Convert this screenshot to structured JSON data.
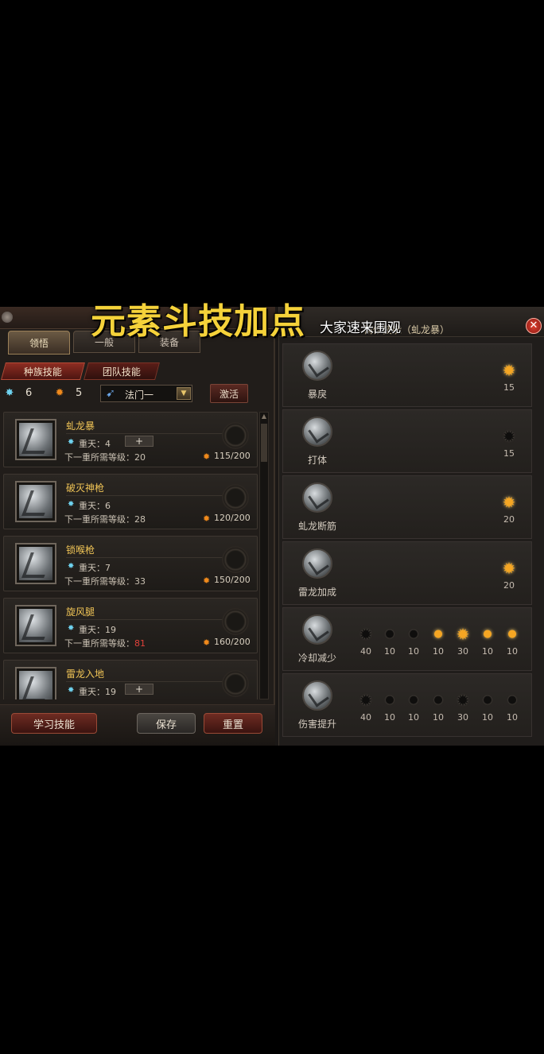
{
  "overlay": {
    "main_caption": "元素斗技加点",
    "sub_caption": "大家速来围观"
  },
  "left_panel": {
    "tabs": [
      {
        "label": "领悟",
        "active": true
      },
      {
        "label": "一般",
        "active": false
      },
      {
        "label": "装备",
        "active": false
      }
    ],
    "subtabs": [
      {
        "label": "种族技能",
        "active": true
      },
      {
        "label": "团队技能",
        "active": false
      }
    ],
    "points": {
      "blue": "6",
      "orange": "5"
    },
    "class_select": {
      "value": "法门一"
    },
    "activate_label": "激活",
    "skills": [
      {
        "name": "虬龙暴",
        "level": "重天：4",
        "req_prefix": "下一重所需等级：",
        "req_value": "20",
        "req_red": false,
        "cost": "115/200",
        "has_plus": true
      },
      {
        "name": "破灭神枪",
        "level": "重天：6",
        "req_prefix": "下一重所需等级：",
        "req_value": "28",
        "req_red": false,
        "cost": "120/200",
        "has_plus": false
      },
      {
        "name": "锁喉枪",
        "level": "重天：7",
        "req_prefix": "下一重所需等级：",
        "req_value": "33",
        "req_red": false,
        "cost": "150/200",
        "has_plus": false
      },
      {
        "name": "旋风腿",
        "level": "重天：19",
        "req_prefix": "下一重所需等级：",
        "req_value": "81",
        "req_red": true,
        "cost": "160/200",
        "has_plus": false
      },
      {
        "name": "雷龙入地",
        "level": "重天：19",
        "req_prefix": "",
        "req_value": "",
        "req_red": false,
        "cost": "",
        "has_plus": true
      }
    ],
    "buttons": {
      "learn": "学习技能",
      "save": "保存",
      "reset": "重置"
    }
  },
  "right_panel": {
    "title": "精修技能（虬龙暴）",
    "rows": [
      {
        "label": "暴戾",
        "nodes": [
          {
            "value": "15",
            "active": true,
            "shape": "star"
          }
        ]
      },
      {
        "label": "打体",
        "nodes": [
          {
            "value": "15",
            "active": false,
            "shape": "star"
          }
        ]
      },
      {
        "label": "虬龙断筋",
        "nodes": [
          {
            "value": "20",
            "active": true,
            "shape": "star"
          }
        ]
      },
      {
        "label": "雷龙加成",
        "nodes": [
          {
            "value": "20",
            "active": true,
            "shape": "star"
          }
        ]
      },
      {
        "label": "冷却减少",
        "nodes": [
          {
            "value": "40",
            "active": false,
            "shape": "star"
          },
          {
            "value": "10",
            "active": false,
            "shape": "dot"
          },
          {
            "value": "10",
            "active": false,
            "shape": "dot"
          },
          {
            "value": "10",
            "active": true,
            "shape": "dot"
          },
          {
            "value": "30",
            "active": true,
            "shape": "star"
          },
          {
            "value": "10",
            "active": true,
            "shape": "dot"
          },
          {
            "value": "10",
            "active": true,
            "shape": "dot"
          }
        ]
      },
      {
        "label": "伤害提升",
        "nodes": [
          {
            "value": "40",
            "active": false,
            "shape": "star"
          },
          {
            "value": "10",
            "active": false,
            "shape": "dot"
          },
          {
            "value": "10",
            "active": false,
            "shape": "dot"
          },
          {
            "value": "10",
            "active": false,
            "shape": "dot"
          },
          {
            "value": "30",
            "active": false,
            "shape": "star"
          },
          {
            "value": "10",
            "active": false,
            "shape": "dot"
          },
          {
            "value": "10",
            "active": false,
            "shape": "dot"
          }
        ]
      }
    ]
  },
  "colors": {
    "accent_gold": "#f0c456",
    "active_node": "#f5a623",
    "warning_red": "#e0413a"
  },
  "icons": {
    "blue_point": "blue-star-icon",
    "orange_point": "orange-flame-icon",
    "close": "close-icon"
  }
}
